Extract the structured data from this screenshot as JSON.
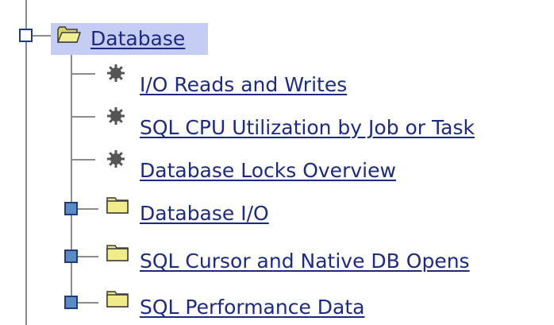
{
  "tree": {
    "root": {
      "label": "Database",
      "expanded": true,
      "selected": true,
      "icon": "open-folder-icon"
    },
    "reports": [
      {
        "label": "I/O Reads and Writes",
        "icon": "gear-bullet-icon"
      },
      {
        "label": "SQL CPU Utilization by Job or Task",
        "icon": "gear-bullet-icon"
      },
      {
        "label": "Database Locks Overview",
        "icon": "gear-bullet-icon"
      }
    ],
    "folders": [
      {
        "label": "Database I/O",
        "expanded": false,
        "icon": "closed-folder-icon"
      },
      {
        "label": "SQL Cursor and Native DB Opens",
        "expanded": false,
        "icon": "closed-folder-icon"
      },
      {
        "label": "SQL Performance Data",
        "expanded": false,
        "icon": "closed-folder-icon"
      }
    ]
  },
  "colors": {
    "link": "#1c2a80",
    "selection": "#c6cdf5",
    "expander_collapsed": "#5b8bc3",
    "folder": "#e9e57a",
    "tree_line": "#8c8c8c"
  }
}
